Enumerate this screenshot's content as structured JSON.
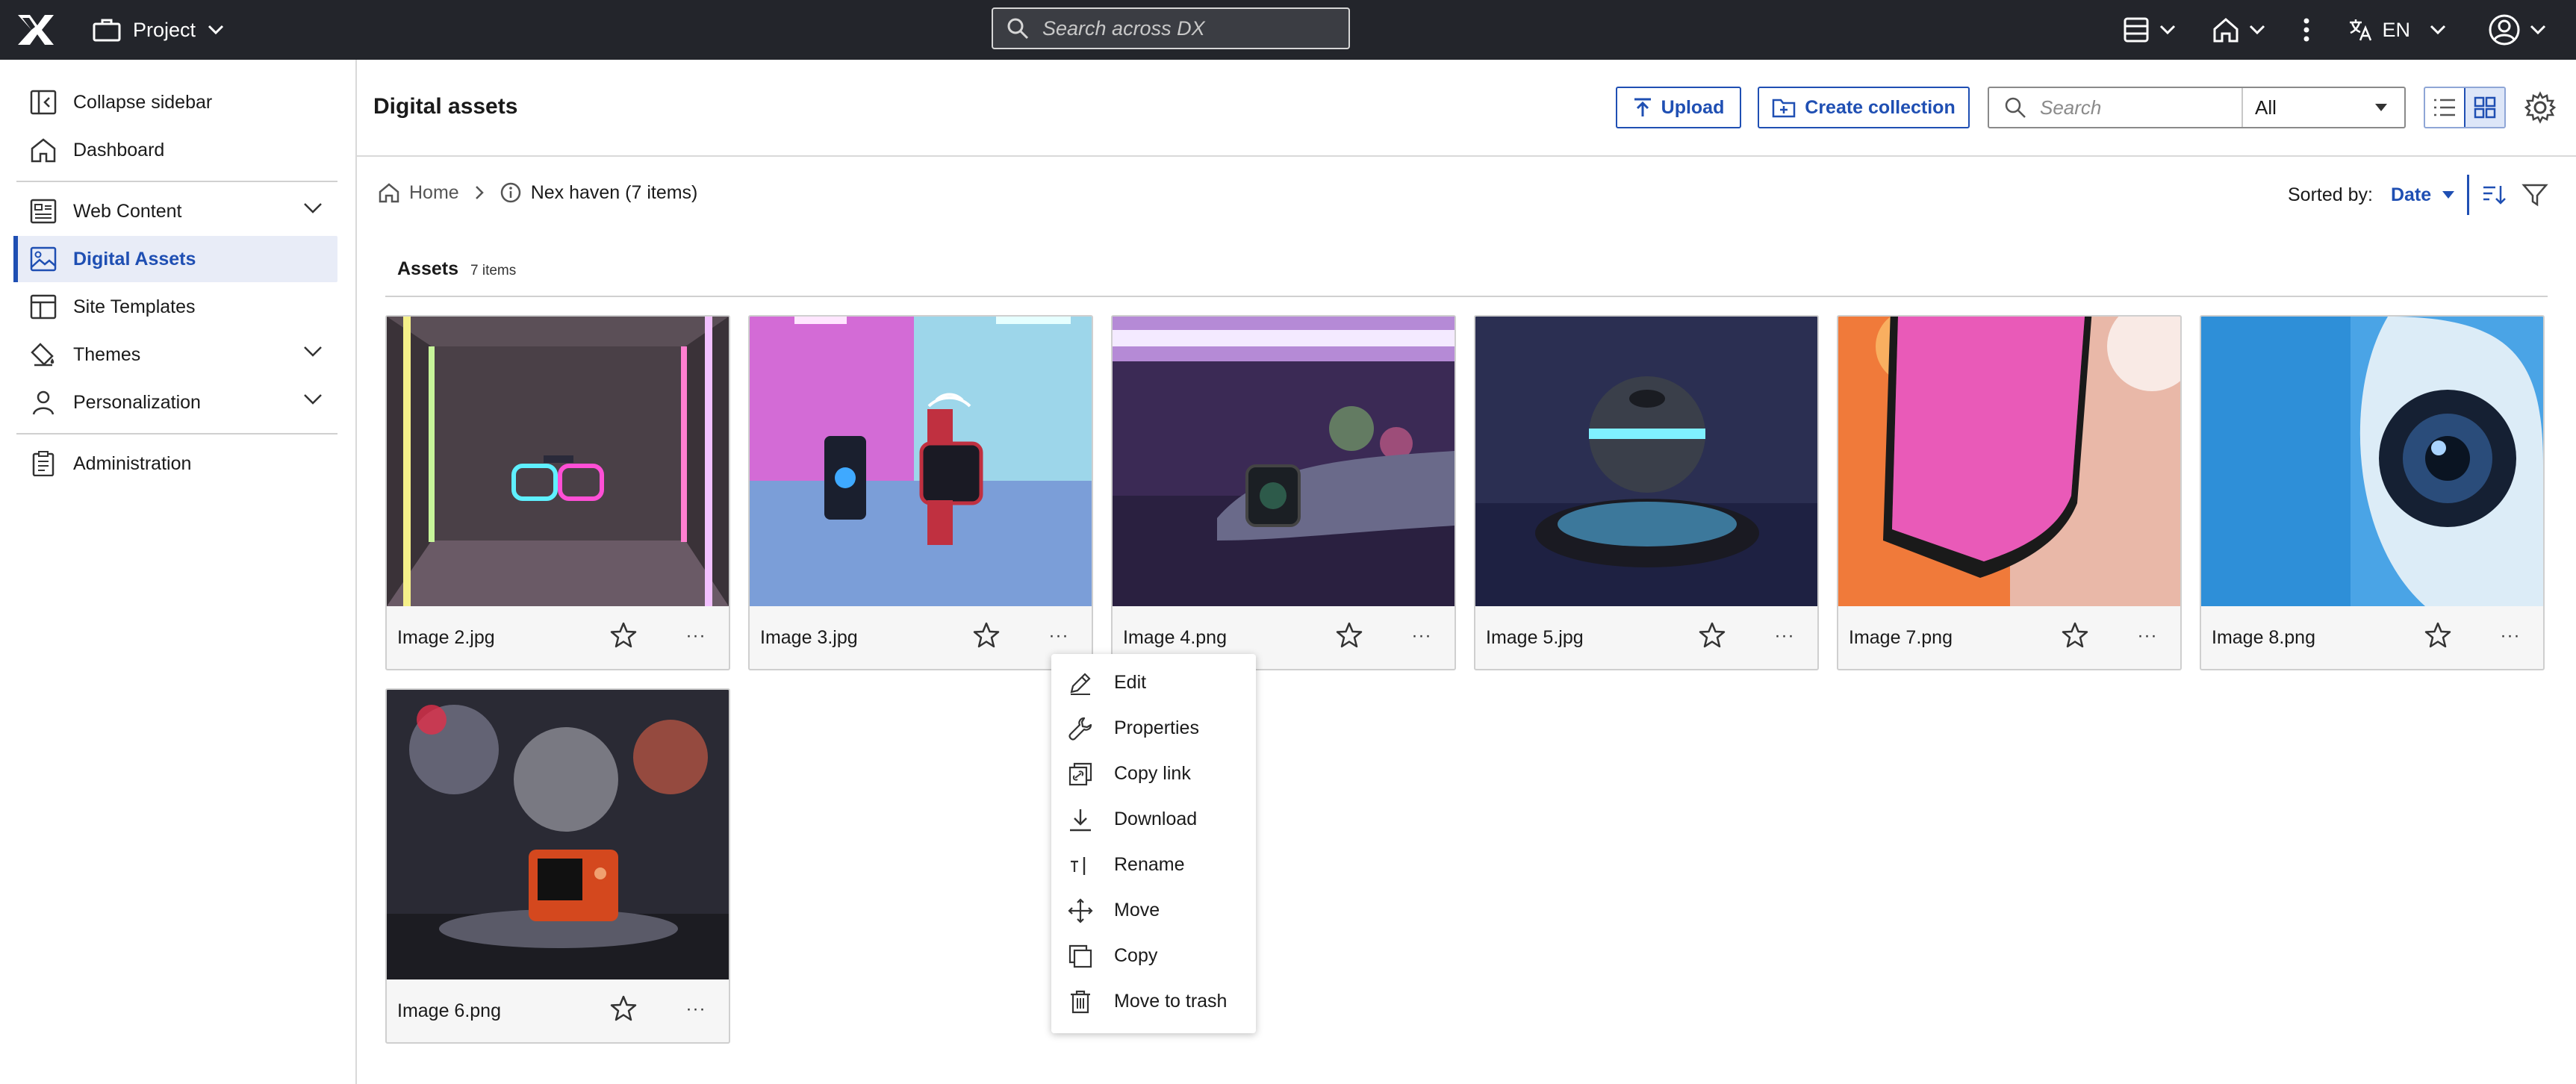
{
  "topbar": {
    "project_label": "Project",
    "search_placeholder": "Search across DX",
    "language": "EN"
  },
  "sidebar": {
    "items": [
      {
        "label": "Collapse sidebar",
        "icon": "collapse-sidebar-icon"
      },
      {
        "label": "Dashboard",
        "icon": "home-icon"
      },
      {
        "label": "Web Content",
        "icon": "web-content-icon",
        "expandable": true
      },
      {
        "label": "Digital Assets",
        "icon": "digital-assets-icon",
        "active": true
      },
      {
        "label": "Site Templates",
        "icon": "site-templates-icon"
      },
      {
        "label": "Themes",
        "icon": "themes-icon",
        "expandable": true
      },
      {
        "label": "Personalization",
        "icon": "person-icon",
        "expandable": true
      },
      {
        "label": "Administration",
        "icon": "clipboard-icon"
      }
    ]
  },
  "header": {
    "title": "Digital assets",
    "upload_label": "Upload",
    "create_collection_label": "Create collection",
    "search_placeholder": "Search",
    "filter_value": "All"
  },
  "breadcrumb": {
    "home": "Home",
    "current": "Nex haven (7 items)"
  },
  "sort": {
    "label": "Sorted by:",
    "value": "Date"
  },
  "assets": {
    "title": "Assets",
    "count": "7 items",
    "items": [
      {
        "name": "Image 2.jpg"
      },
      {
        "name": "Image 3.jpg"
      },
      {
        "name": "Image 4.png"
      },
      {
        "name": "Image 5.jpg"
      },
      {
        "name": "Image 7.png"
      },
      {
        "name": "Image 8.png"
      },
      {
        "name": "Image 6.png"
      }
    ]
  },
  "context_menu": {
    "items": [
      {
        "label": "Edit",
        "icon": "pencil-icon"
      },
      {
        "label": "Properties",
        "icon": "wrench-icon"
      },
      {
        "label": "Copy link",
        "icon": "copy-link-icon"
      },
      {
        "label": "Download",
        "icon": "download-icon"
      },
      {
        "label": "Rename",
        "icon": "rename-icon"
      },
      {
        "label": "Move",
        "icon": "move-icon"
      },
      {
        "label": "Copy",
        "icon": "copy-icon"
      },
      {
        "label": "Move to trash",
        "icon": "trash-icon"
      }
    ]
  },
  "colors": {
    "topbar_bg": "#23252b",
    "accent": "#1f4fb3",
    "active_bg": "#e8ecf7"
  }
}
